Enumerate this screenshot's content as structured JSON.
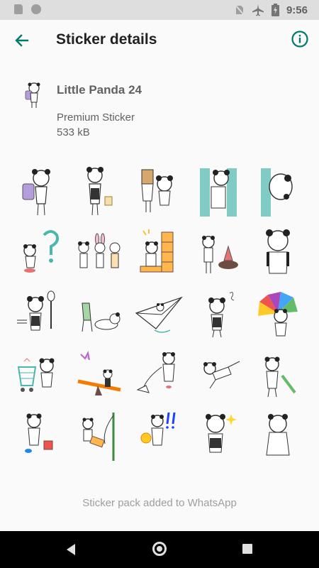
{
  "status_bar": {
    "time": "9:56",
    "icons": [
      "sd-card-icon",
      "circle-icon",
      "no-sim-icon",
      "airplane-icon",
      "battery-charging-icon"
    ]
  },
  "app_bar": {
    "title": "Sticker details",
    "back_icon": "arrow-left-icon",
    "info_icon": "info-icon",
    "accent": "#00796b"
  },
  "pack": {
    "name": "Little Panda 24",
    "publisher": "Premium Sticker",
    "size": "533 kB"
  },
  "stickers": [
    {
      "desc": "panda with purple backpack"
    },
    {
      "desc": "panda holding bag"
    },
    {
      "desc": "box head panda"
    },
    {
      "desc": "panda peeking teal door"
    },
    {
      "desc": "panda hiding teal wall"
    },
    {
      "desc": "panda question mark"
    },
    {
      "desc": "three animals"
    },
    {
      "desc": "panda with boxes"
    },
    {
      "desc": "panda with red cone"
    },
    {
      "desc": "sad panda"
    },
    {
      "desc": "panda with fork"
    },
    {
      "desc": "panda on chair"
    },
    {
      "desc": "panda paper plane"
    },
    {
      "desc": "panda dizzy"
    },
    {
      "desc": "panda colorful fan"
    },
    {
      "desc": "panda shopping cart"
    },
    {
      "desc": "panda seesaw"
    },
    {
      "desc": "panda with lamp"
    },
    {
      "desc": "panda jumping"
    },
    {
      "desc": "panda umbrella"
    },
    {
      "desc": "panda with basket"
    },
    {
      "desc": "panda with flag"
    },
    {
      "desc": "panda exclamation"
    },
    {
      "desc": "panda sparkles"
    },
    {
      "desc": "panda ghost"
    }
  ],
  "footer": {
    "status_text": "Sticker pack added to WhatsApp"
  },
  "nav_bar": {
    "icons": [
      "nav-back-icon",
      "nav-home-icon",
      "nav-recents-icon"
    ]
  }
}
